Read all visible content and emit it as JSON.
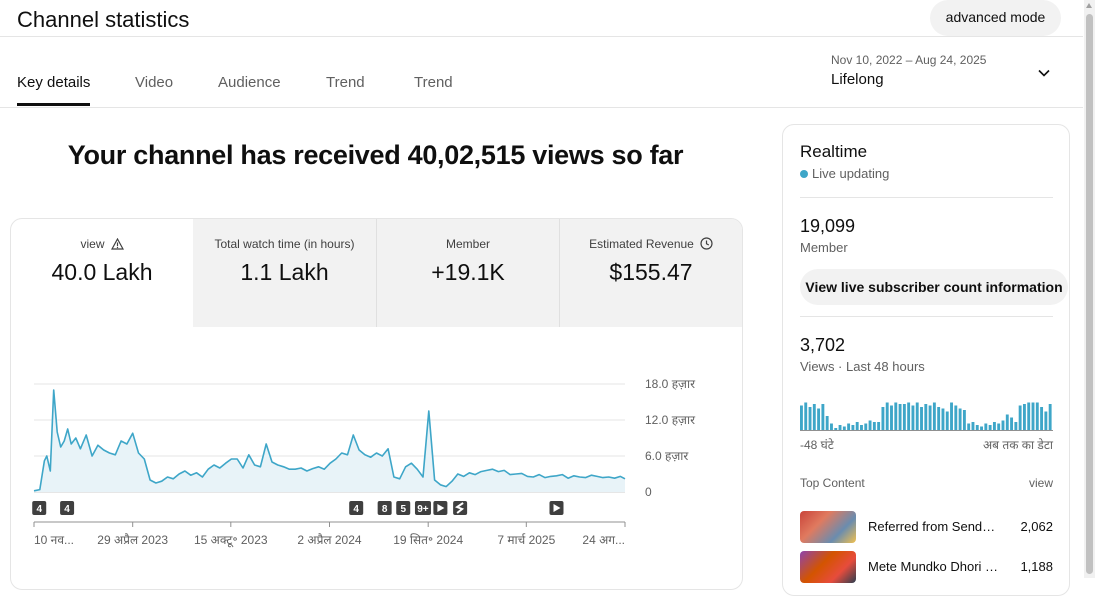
{
  "header": {
    "title": "Channel statistics",
    "advanced_label": "advanced mode"
  },
  "tabs": [
    {
      "label": "Key details",
      "active": true
    },
    {
      "label": "Video",
      "active": false
    },
    {
      "label": "Audience",
      "active": false
    },
    {
      "label": "Trend",
      "active": false
    },
    {
      "label": "Trend",
      "active": false
    }
  ],
  "date_picker": {
    "range": "Nov 10, 2022 – Aug 24, 2025",
    "label": "Lifelong"
  },
  "headline": "Your channel has received 40,02,515 views so far",
  "metrics": [
    {
      "label": "view",
      "value": "40.0 Lakh",
      "icon": "warning-icon",
      "selected": true
    },
    {
      "label": "Total watch time (in hours)",
      "value": "1.1 Lakh",
      "selected": false
    },
    {
      "label": "Member",
      "value": "+19.1K",
      "selected": false
    },
    {
      "label": "Estimated Revenue",
      "value": "$155.47",
      "icon": "clock-icon",
      "selected": false
    }
  ],
  "chart_data": {
    "type": "area",
    "color": "#3ea6c8",
    "fill": "#e8f3f8",
    "ylim": [
      0,
      20000
    ],
    "y_ticks": [
      {
        "value": 0,
        "label": "0"
      },
      {
        "value": 6000,
        "label": "6.0 हज़ार"
      },
      {
        "value": 12000,
        "label": "12.0 हज़ार"
      },
      {
        "value": 18000,
        "label": "18.0 हज़ार"
      }
    ],
    "x_labels": [
      "10 नव...",
      "29 अप्रैल 2023",
      "15 अक्टू॰ 2023",
      "2 अप्रैल 2024",
      "19 सित॰ 2024",
      "7 मार्च 2025",
      "24 अग..."
    ],
    "x_label_days": [
      0,
      170,
      339,
      509,
      679,
      848,
      1018
    ],
    "total_days": 1018,
    "series": [
      {
        "x": [
          0,
          10,
          18,
          22,
          28,
          34,
          40,
          46,
          52,
          58,
          64,
          72,
          80,
          90,
          100,
          110,
          120,
          130,
          140,
          150,
          160,
          170,
          180,
          190,
          200,
          210,
          220,
          230,
          240,
          250,
          260,
          270,
          280,
          290,
          300,
          310,
          320,
          330,
          340,
          350,
          360,
          370,
          380,
          390,
          400,
          410,
          420,
          430,
          440,
          450,
          460,
          470,
          480,
          490,
          500,
          510,
          520,
          530,
          540,
          550,
          560,
          570,
          580,
          590,
          600,
          610,
          620,
          630,
          640,
          650,
          660,
          670,
          680,
          690,
          700,
          710,
          720,
          730,
          740,
          750,
          760,
          770,
          780,
          790,
          800,
          810,
          820,
          830,
          840,
          850,
          860,
          870,
          880,
          890,
          900,
          910,
          920,
          930,
          940,
          950,
          960,
          970,
          980,
          990,
          1000,
          1010,
          1018
        ],
        "y": [
          200,
          400,
          5200,
          6000,
          3500,
          17000,
          10000,
          7500,
          8500,
          10500,
          8000,
          9000,
          7200,
          9500,
          6000,
          7800,
          7000,
          6500,
          6200,
          8500,
          8000,
          9800,
          6500,
          5500,
          2000,
          1500,
          1800,
          2500,
          2200,
          3000,
          3500,
          2800,
          3200,
          2500,
          3800,
          4500,
          4000,
          4800,
          5500,
          5500,
          4000,
          6200,
          4500,
          4200,
          8000,
          5000,
          4500,
          4200,
          3800,
          3800,
          4000,
          3500,
          3900,
          4200,
          3800,
          4800,
          5500,
          6500,
          6200,
          9500,
          7000,
          6200,
          5800,
          6500,
          6000,
          7200,
          2500,
          2200,
          4200,
          4800,
          3800,
          2500,
          13500,
          2000,
          1200,
          900,
          1800,
          3000,
          2600,
          3200,
          2900,
          3400,
          3600,
          3800,
          3400,
          3600,
          2900,
          3000,
          3100,
          2600,
          2500,
          2900,
          2400,
          2600,
          2700,
          2900,
          2300,
          2700,
          2500,
          2400,
          2800,
          2600,
          2400,
          2500,
          2300,
          2600,
          2200
        ]
      }
    ],
    "markers": [
      {
        "day": 9,
        "label": "4",
        "kind": "number"
      },
      {
        "day": 57,
        "label": "4",
        "kind": "number"
      },
      {
        "day": 555,
        "label": "4",
        "kind": "number"
      },
      {
        "day": 604,
        "label": "8",
        "kind": "number"
      },
      {
        "day": 636,
        "label": "5",
        "kind": "number"
      },
      {
        "day": 670,
        "label": "9+",
        "kind": "number"
      },
      {
        "day": 700,
        "label": "",
        "kind": "play"
      },
      {
        "day": 734,
        "label": "",
        "kind": "shorts"
      },
      {
        "day": 900,
        "label": "",
        "kind": "play"
      }
    ],
    "grid": true
  },
  "realtime": {
    "title": "Realtime",
    "live_label": "Live updating",
    "subscriber_count": "19,099",
    "subscriber_label": "Member",
    "live_button": "View live subscriber count information",
    "views_count": "3,702",
    "views_label": "Views · Last 48 hours",
    "axis_left": "-48 घंटे",
    "axis_right": "अब तक का डेटा",
    "bars": [
      0.85,
      0.95,
      0.8,
      0.9,
      0.75,
      0.9,
      0.5,
      0.25,
      0.1,
      0.2,
      0.15,
      0.25,
      0.2,
      0.3,
      0.2,
      0.25,
      0.35,
      0.3,
      0.3,
      0.8,
      0.95,
      0.85,
      0.95,
      0.9,
      0.9,
      0.95,
      0.85,
      0.95,
      0.8,
      0.9,
      0.85,
      0.95,
      0.8,
      0.75,
      0.65,
      0.95,
      0.85,
      0.75,
      0.7,
      0.25,
      0.3,
      0.2,
      0.15,
      0.25,
      0.2,
      0.3,
      0.25,
      0.35,
      0.55,
      0.45,
      0.3,
      0.85,
      0.9,
      0.95,
      0.95,
      0.95,
      0.8,
      0.65,
      0.9
    ],
    "bar_color": "#3ea6c8",
    "top_content_label": "Top Content",
    "top_content_metric": "view",
    "top_content": [
      {
        "title": "Referred from Sendh…",
        "views": "2,062"
      },
      {
        "title": "Mete Mundko Dhori …",
        "views": "1,188"
      }
    ]
  }
}
